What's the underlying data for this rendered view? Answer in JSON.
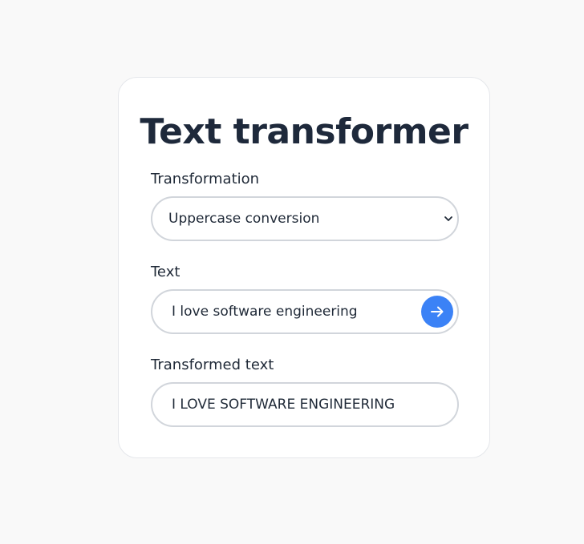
{
  "title": "Text transformer",
  "transformation": {
    "label": "Transformation",
    "selected": "Uppercase conversion"
  },
  "text": {
    "label": "Text",
    "value": "I love software engineering"
  },
  "result": {
    "label": "Transformed text",
    "value": "I LOVE SOFTWARE ENGINEERING"
  },
  "icons": {
    "select": "chevron-down-icon",
    "submit": "arrow-right-icon"
  },
  "colors": {
    "accent": "#3b82f6",
    "background": "#f9f9f9",
    "card": "#ffffff",
    "border": "#d1d5db",
    "title": "#1e293b"
  }
}
